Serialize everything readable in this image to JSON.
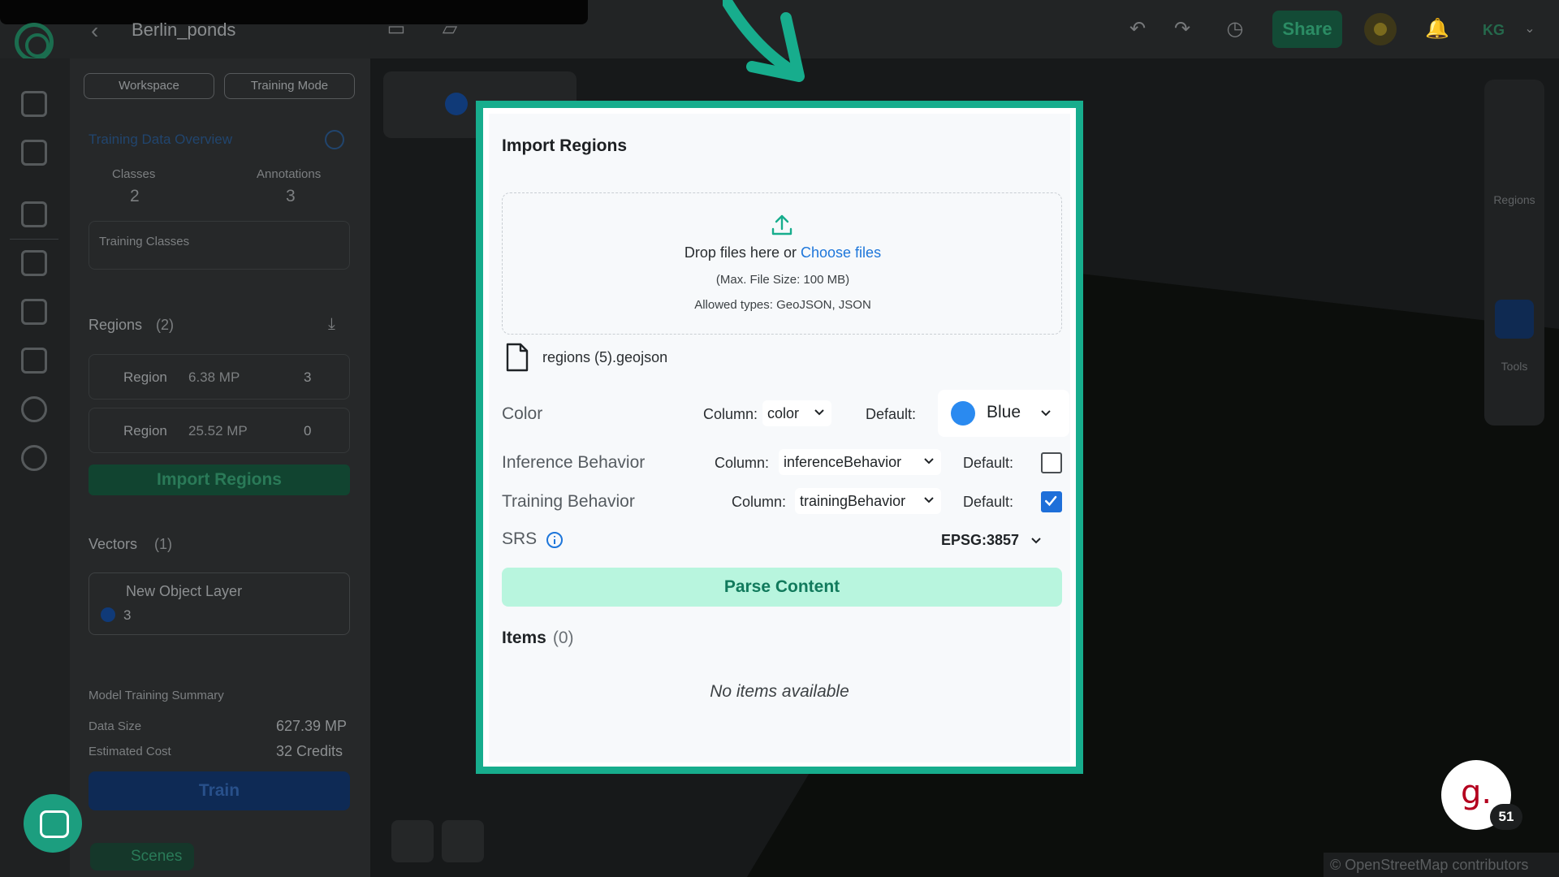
{
  "topbar": {
    "project_title": "Berlin_ponds",
    "share_label": "Share",
    "user_initials": "KG"
  },
  "left_panel": {
    "workspace_label": "Workspace",
    "training_mode_label": "Training Mode",
    "training_overview_title": "Training Data Overview",
    "classes_label": "Classes",
    "classes_value": "2",
    "annotations_label": "Annotations",
    "annotations_value": "3",
    "training_classes_placeholder": "Training Classes",
    "regions_title": "Regions",
    "regions_count": "(2)",
    "regions": [
      {
        "label": "Region",
        "size": "6.38 MP",
        "count": "3"
      },
      {
        "label": "Region",
        "size": "25.52 MP",
        "count": "0"
      }
    ],
    "import_regions_label": "Import Regions",
    "vectors_title": "Vectors",
    "vectors_count": "(1)",
    "vector_layer_name": "New Object Layer",
    "vector_layer_count": "3",
    "summary_title": "Model Training Summary",
    "data_size_label": "Data Size",
    "data_size_value": "627.39 MP",
    "est_cost_label": "Estimated Cost",
    "est_cost_value": "32 Credits",
    "train_label": "Train",
    "scenes_label": "Scenes"
  },
  "map": {
    "right_tools_regions_label": "Regions",
    "right_tools_tools_label": "Tools",
    "attribution": "© OpenStreetMap contributors",
    "badge_letter": "g.",
    "badge_count": "51"
  },
  "modal": {
    "title": "Import Regions",
    "drop_text": "Drop files here",
    "or_text": "or",
    "choose_files": "Choose files",
    "max_size": "(Max. File Size: 100 MB)",
    "allowed_types": "Allowed types: GeoJSON, JSON",
    "file_name": "regions (5).geojson",
    "color_label": "Color",
    "column_label": "Column:",
    "default_label": "Default:",
    "color_column_value": "color",
    "color_default_value": "Blue",
    "inference_label": "Inference Behavior",
    "inference_column_value": "inferenceBehavior",
    "inference_default_checked": false,
    "training_label": "Training Behavior",
    "training_column_value": "trainingBehavior",
    "training_default_checked": true,
    "srs_label": "SRS",
    "srs_value": "EPSG:3857",
    "parse_label": "Parse Content",
    "items_label": "Items",
    "items_count": "(0)",
    "empty_text": "No items available"
  },
  "colors": {
    "modal_border": "#17ad8d",
    "parse_bg": "#b8f5de",
    "link_blue": "#1d76da",
    "default_blue": "#2a8af0"
  }
}
